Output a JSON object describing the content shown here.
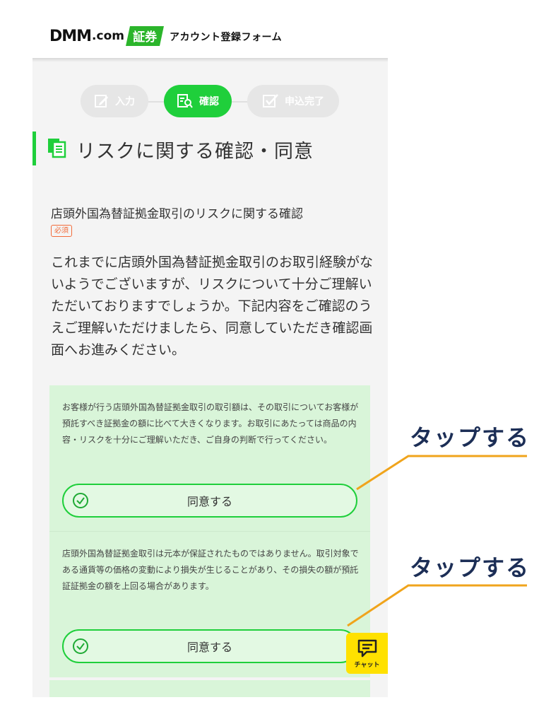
{
  "header": {
    "logo_dmm": "DMM",
    "logo_com": ".com",
    "logo_badge": "証券",
    "title": "アカウント登録フォーム"
  },
  "stepper": {
    "steps": [
      {
        "label": "入力",
        "state": "done",
        "icon": "edit-icon"
      },
      {
        "label": "確認",
        "state": "active",
        "icon": "search-document-icon"
      },
      {
        "label": "申込完了",
        "state": "pending",
        "icon": "checkbox-icon"
      }
    ]
  },
  "section": {
    "title": "リスクに関する確認・同意",
    "icon": "documents-icon"
  },
  "question": {
    "title": "店頭外国為替証拠金取引のリスクに関する確認",
    "required_label": "必須",
    "intro": "これまでに店頭外国為替証拠金取引のお取引経験がないようでございますが、リスクについて十分ご理解いただいておりますでしょうか。下記内容をご確認のうえご理解いただけましたら、同意していただき確認画面へお進みください。"
  },
  "risk_items": [
    {
      "text": "お客様が行う店頭外国為替証拠金取引の取引額は、その取引についてお客様が預託すべき証拠金の額に比べて大きくなります。お取引にあたっては商品の内容・リスクを十分にご理解いただき、ご自身の判断で行ってください。",
      "button_label": "同意する"
    },
    {
      "text": "店頭外国為替証拠金取引は元本が保証されたものではありません。取引対象である通貨等の価格の変動により損失が生じることがあり、その損失の額が預託証証拠金の額を上回る場合があります。",
      "button_label": "同意する"
    }
  ],
  "chat": {
    "label": "チャット"
  },
  "annotations": [
    "タップする",
    "タップする"
  ],
  "colors": {
    "accent_green": "#1fcf3b",
    "box_green": "#d9f5d9",
    "required_orange": "#f26b3a",
    "chat_yellow": "#ffe100",
    "annotation_navy": "#1c2e56",
    "callout_line": "#f0a41c"
  }
}
